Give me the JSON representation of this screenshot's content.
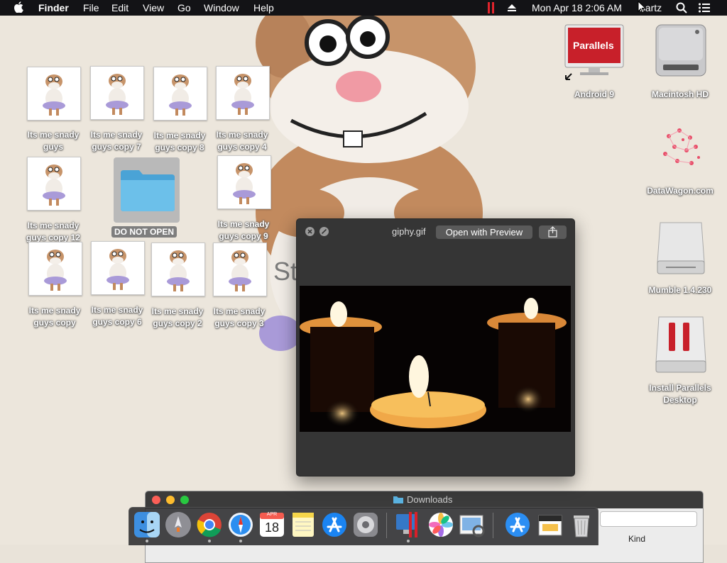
{
  "menubar": {
    "apple": "",
    "app_name": "Finder",
    "items": [
      "File",
      "Edit",
      "View",
      "Go",
      "Window",
      "Help"
    ],
    "datetime": "Mon Apr 18  2:06 AM",
    "user": "bartz"
  },
  "desktop": {
    "image_icons": [
      {
        "label": "Its me snady guys"
      },
      {
        "label": "Its me snady guys copy 7"
      },
      {
        "label": "Its me snady guys copy 8"
      },
      {
        "label": "Its me snady guys copy 4"
      },
      {
        "label": "Its me snady guys copy 12"
      },
      {
        "label": "Its me snady guys copy 9"
      },
      {
        "label": "Its me snady guys copy"
      },
      {
        "label": "Its me snady guys copy 6"
      },
      {
        "label": "Its me snady guys copy 2"
      },
      {
        "label": "Its me snady guys copy 3"
      }
    ],
    "folder": {
      "label": "DO NOT OPEN"
    },
    "right_icons": [
      {
        "label": "Android 9",
        "badge": "Parallels"
      },
      {
        "label": "Macintosh HD"
      },
      {
        "label": "DataWagon.com"
      },
      {
        "label": "Mumble 1.4.230"
      },
      {
        "label": "Install Parallels Desktop"
      }
    ]
  },
  "quicklook": {
    "filename": "giphy.gif",
    "open_button": "Open with Preview"
  },
  "downloads": {
    "title": "Downloads",
    "column_kind": "Kind"
  },
  "dock": {
    "calendar_month": "APR",
    "calendar_day": "18",
    "apps": [
      "Finder",
      "Launchpad",
      "Chrome",
      "Safari",
      "Calendar",
      "Notes",
      "App Store",
      "System Preferences",
      "Parallels Desktop",
      "Photos",
      "Preview",
      "App Store",
      "Downloads",
      "Trash"
    ]
  },
  "colors": {
    "menubar_bg": "#131316",
    "folder_blue": "#5ab2e0",
    "parallels_red": "#c8202a",
    "close_red": "#fc5f57",
    "minimize_yellow": "#fdbc2e",
    "zoom_green": "#28c840"
  }
}
